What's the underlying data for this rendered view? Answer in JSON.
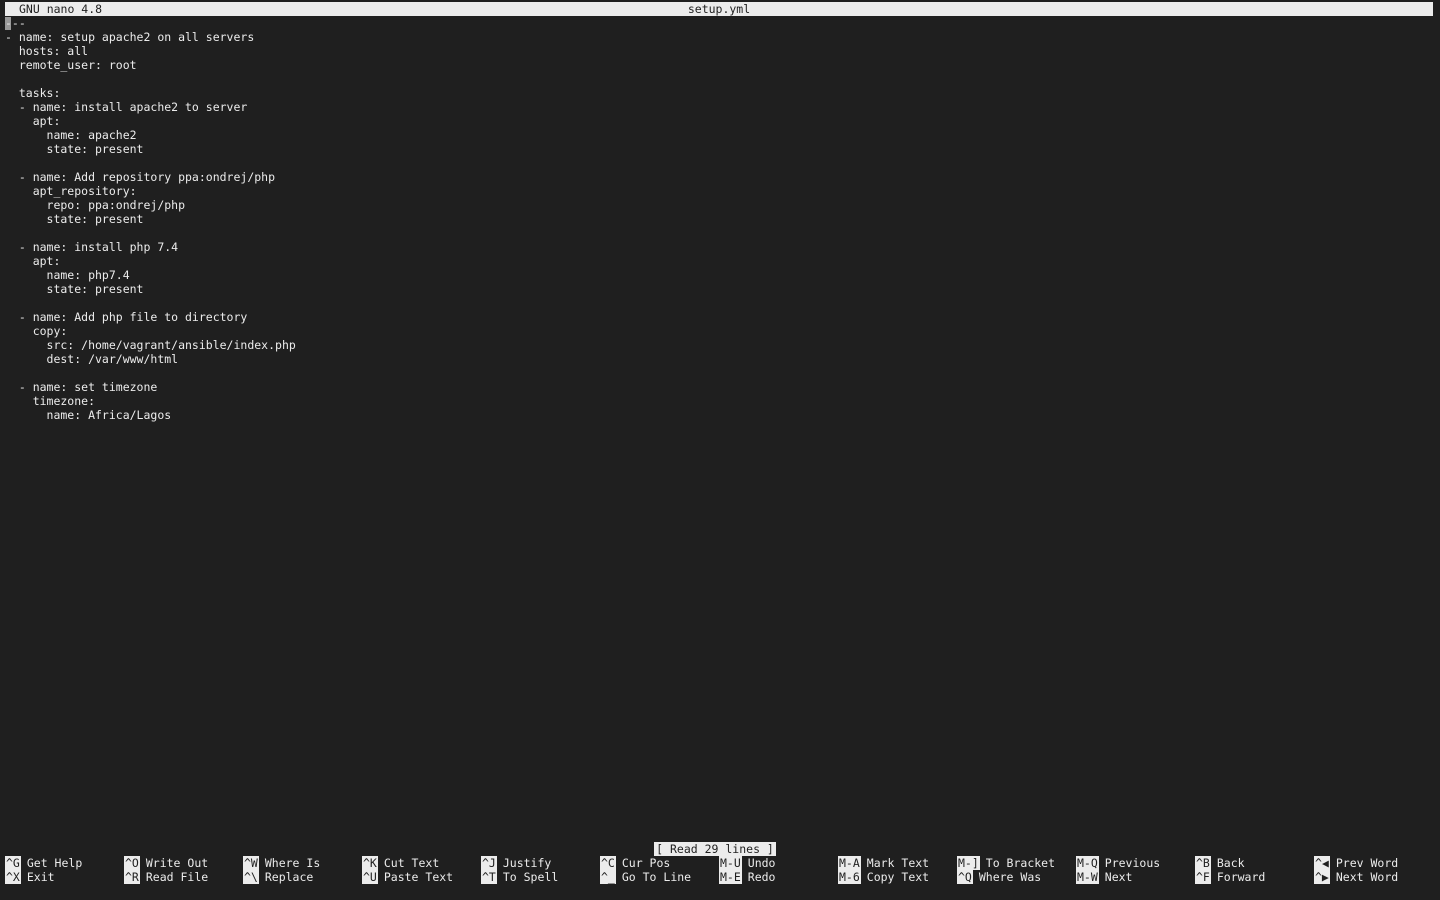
{
  "titlebar": {
    "app": "GNU nano 4.8",
    "filename": "setup.yml"
  },
  "editor": {
    "lines": [
      "---",
      "- name: setup apache2 on all servers",
      "  hosts: all",
      "  remote_user: root",
      "",
      "  tasks:",
      "  - name: install apache2 to server",
      "    apt:",
      "      name: apache2",
      "      state: present",
      "",
      "  - name: Add repository ppa:ondrej/php",
      "    apt_repository:",
      "      repo: ppa:ondrej/php",
      "      state: present",
      "",
      "  - name: install php 7.4",
      "    apt:",
      "      name: php7.4",
      "      state: present",
      "",
      "  - name: Add php file to directory",
      "    copy:",
      "      src: /home/vagrant/ansible/index.php",
      "      dest: /var/www/html",
      "",
      "  - name: set timezone",
      "    timezone:",
      "      name: Africa/Lagos"
    ]
  },
  "status": "[ Read 29 lines ]",
  "shortcuts": {
    "row1": [
      {
        "key": "^G",
        "label": "Get Help"
      },
      {
        "key": "^O",
        "label": "Write Out"
      },
      {
        "key": "^W",
        "label": "Where Is"
      },
      {
        "key": "^K",
        "label": "Cut Text"
      },
      {
        "key": "^J",
        "label": "Justify"
      },
      {
        "key": "^C",
        "label": "Cur Pos"
      },
      {
        "key": "M-U",
        "label": "Undo"
      },
      {
        "key": "M-A",
        "label": "Mark Text"
      },
      {
        "key": "M-]",
        "label": "To Bracket"
      },
      {
        "key": "M-Q",
        "label": "Previous"
      },
      {
        "key": "^B",
        "label": "Back"
      },
      {
        "key": "^◀",
        "label": "Prev Word"
      }
    ],
    "row2": [
      {
        "key": "^X",
        "label": "Exit"
      },
      {
        "key": "^R",
        "label": "Read File"
      },
      {
        "key": "^\\",
        "label": "Replace"
      },
      {
        "key": "^U",
        "label": "Paste Text"
      },
      {
        "key": "^T",
        "label": "To Spell"
      },
      {
        "key": "^_",
        "label": "Go To Line"
      },
      {
        "key": "M-E",
        "label": "Redo"
      },
      {
        "key": "M-6",
        "label": "Copy Text"
      },
      {
        "key": "^Q",
        "label": "Where Was"
      },
      {
        "key": "M-W",
        "label": "Next"
      },
      {
        "key": "^F",
        "label": "Forward"
      },
      {
        "key": "^▶",
        "label": "Next Word"
      }
    ]
  }
}
